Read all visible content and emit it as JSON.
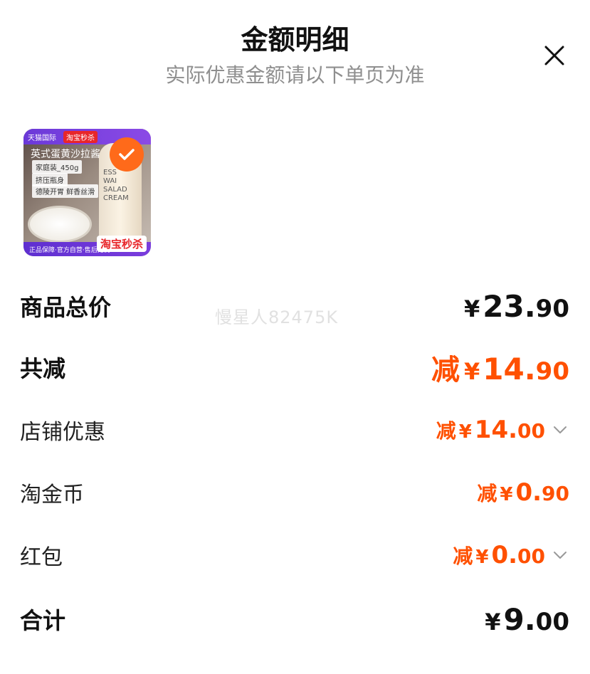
{
  "header": {
    "title": "金额明细",
    "subtitle": "实际优惠金额请以下单页为准"
  },
  "product": {
    "image_icon": "product-thumbnail",
    "badge_icon": "checkmark-icon",
    "img_top_left": "天猫国际",
    "img_top_tag": "淘宝秒杀",
    "img_name": "英式蛋黄沙拉酱",
    "img_spec": "家庭装_450g",
    "img_tag1": "挤压瓶身",
    "img_tag2": "德陵开胃 鲜香丝滑",
    "img_bottle_text": "ESS\nWAI\nSALAD\nCREAM",
    "img_bottom": "正品保障·官方自营·售后无忧",
    "img_miaosha": "淘宝秒杀"
  },
  "watermark": "慢星人82475K",
  "rows": {
    "total_price": {
      "label": "商品总价",
      "yen": "¥",
      "int": "23.",
      "dec": "90"
    },
    "total_reduce": {
      "label": "共减",
      "jian": "减",
      "yen": "¥",
      "int": "14.",
      "dec": "90"
    },
    "shop_discount": {
      "label": "店铺优惠",
      "jian": "减",
      "yen": "¥",
      "int": "14.",
      "dec": "00"
    },
    "taojinbi": {
      "label": "淘金币",
      "jian": "减",
      "yen": "¥",
      "int": "0.",
      "dec": "90"
    },
    "hongbao": {
      "label": "红包",
      "jian": "减",
      "yen": "¥",
      "int": "0.",
      "dec": "00"
    },
    "sum": {
      "label": "合计",
      "yen": "¥",
      "int": "9.",
      "dec": "00"
    }
  },
  "colors": {
    "accent": "#ff5000",
    "subtitle_gray": "#8f8f8f"
  }
}
